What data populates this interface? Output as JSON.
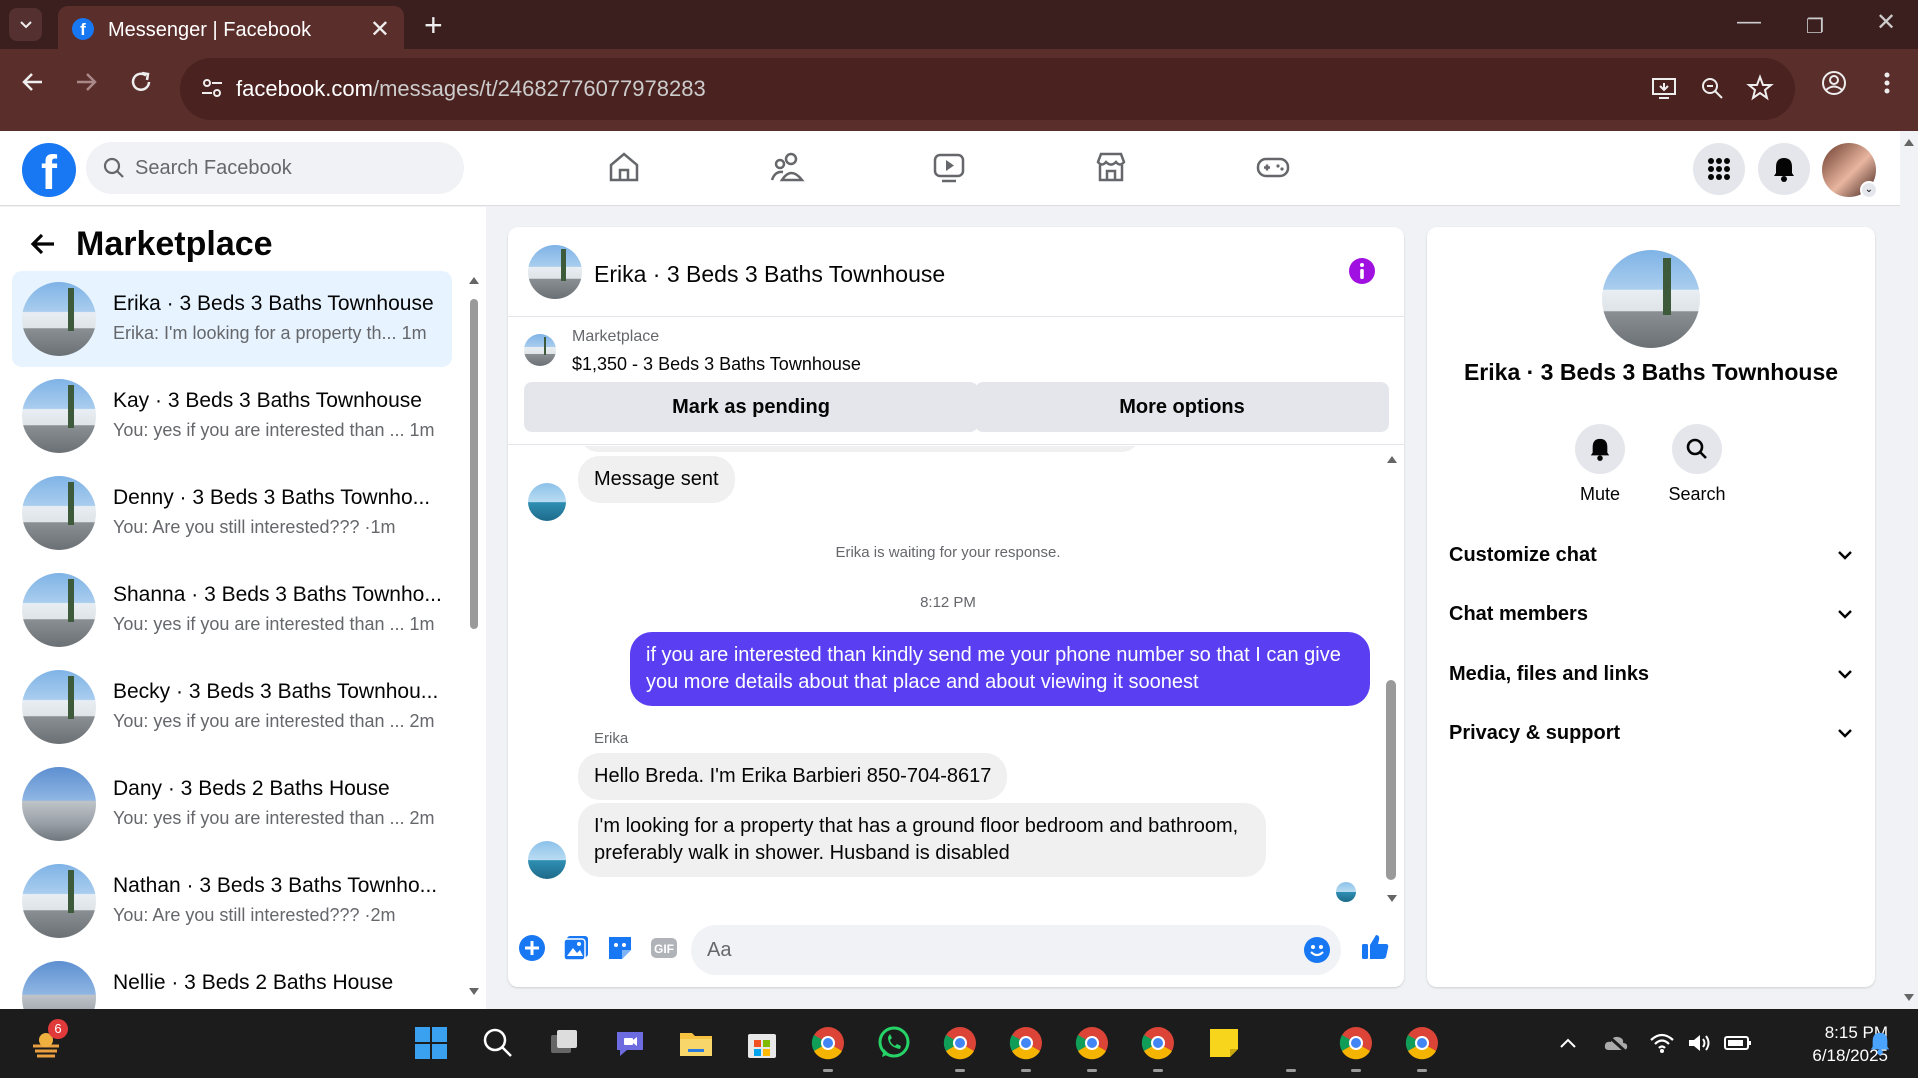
{
  "browser": {
    "tab_title": "Messenger | Facebook",
    "url_host": "facebook.com",
    "url_path": "/messages/t/24682776077978283"
  },
  "fb": {
    "search_placeholder": "Search Facebook"
  },
  "sidebar": {
    "title": "Marketplace",
    "conversations": [
      {
        "name": "Erika · 3 Beds 3 Baths Townhouse",
        "preview": "Erika: I'm looking for a property th...",
        "time": "1m",
        "active": true
      },
      {
        "name": "Kay · 3 Beds 3 Baths Townhouse",
        "preview": "You: yes if you are interested than ...",
        "time": "1m"
      },
      {
        "name": "Denny · 3 Beds 3 Baths Townho...",
        "preview": "You: Are you still interested??? ·",
        "time": "1m"
      },
      {
        "name": "Shanna · 3 Beds 3 Baths Townho...",
        "preview": "You: yes if you are interested than ...",
        "time": "1m"
      },
      {
        "name": "Becky · 3 Beds 3 Baths Townhou...",
        "preview": "You: yes if you are interested than ...",
        "time": "2m"
      },
      {
        "name": "Dany · 3 Beds 2 Baths House",
        "preview": "You: yes if you are interested than ...",
        "time": "2m"
      },
      {
        "name": "Nathan · 3 Beds 3 Baths Townho...",
        "preview": "You: Are you still interested??? ·",
        "time": "2m"
      },
      {
        "name": "Nellie · 3 Beds 2 Baths House",
        "preview": "",
        "time": ""
      }
    ]
  },
  "chat": {
    "title": "Erika · 3 Beds 3 Baths Townhouse",
    "listing_label": "Marketplace",
    "listing_title": "$1,350 - 3 Beds 3 Baths Townhouse",
    "mark_pending": "Mark as pending",
    "more_options": "More options",
    "messages": {
      "sent_notice": "Message sent",
      "waiting": "Erika is waiting for your response.",
      "time_sep": "8:12 PM",
      "outgoing": "if you are interested than kindly send me your phone number so that I can give you more details about that place and about viewing it soonest",
      "sender": "Erika",
      "in1": "Hello Breda.  I'm Erika Barbieri 850-704-8617",
      "in2": "I'm looking for a property that has a ground floor bedroom and bathroom, preferably walk in shower. Husband is disabled"
    },
    "composer_placeholder": "Aa"
  },
  "info": {
    "name": "Erika · 3 Beds 3 Baths Townhouse",
    "mute": "Mute",
    "search": "Search",
    "sections": [
      "Customize chat",
      "Chat members",
      "Media, files and links",
      "Privacy & support"
    ]
  },
  "taskbar": {
    "badge": "6",
    "time": "8:15 PM",
    "date": "6/18/2025"
  },
  "colors": {
    "fb_blue": "#1877f2",
    "outgoing_bubble": "#5a3ff2",
    "info_icon": "#a010e0",
    "chrome_frame": "#5a2e2b"
  }
}
